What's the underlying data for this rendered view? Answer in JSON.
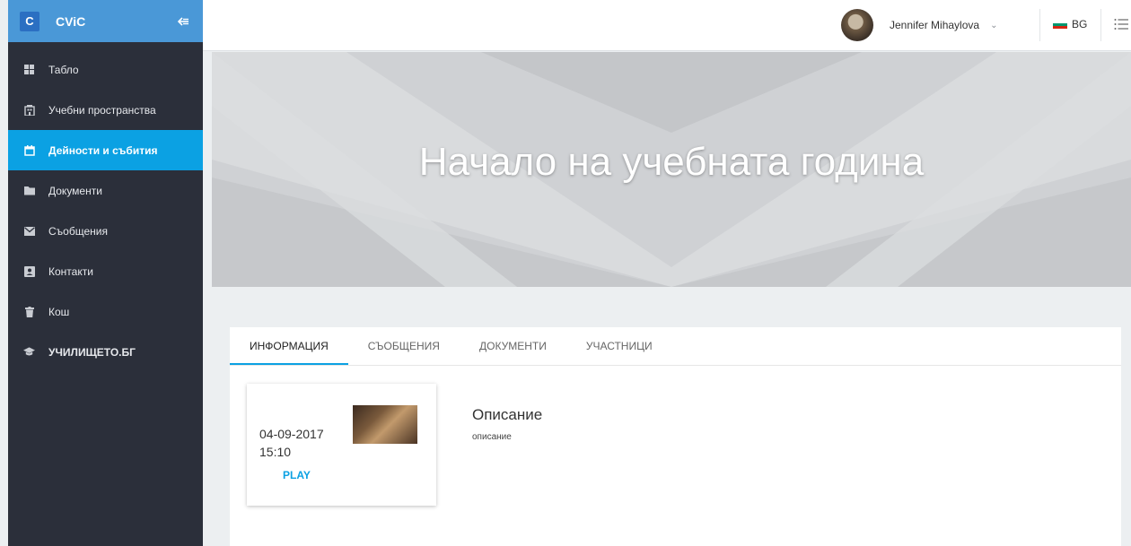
{
  "brand": {
    "logo_letter": "C",
    "name": "CViC"
  },
  "sidebar": {
    "items": [
      {
        "label": "Табло",
        "icon": "grid-icon"
      },
      {
        "label": "Учебни пространства",
        "icon": "building-icon"
      },
      {
        "label": "Дейности и събития",
        "icon": "calendar-icon",
        "active": true
      },
      {
        "label": "Документи",
        "icon": "folder-icon"
      },
      {
        "label": "Съобщения",
        "icon": "envelope-icon"
      },
      {
        "label": "Контакти",
        "icon": "contact-card-icon"
      },
      {
        "label": "Кош",
        "icon": "trash-icon"
      },
      {
        "label": "УЧИЛИЩЕТО.БГ",
        "icon": "graduation-cap-icon"
      }
    ]
  },
  "topbar": {
    "user_name": "Jennifer Mihaylova",
    "language": "BG"
  },
  "banner": {
    "title": "Начало на учебната година"
  },
  "tabs": [
    "ИНФОРМАЦИЯ",
    "СЪОБЩЕНИЯ",
    "ДОКУМЕНТИ",
    "УЧАСТНИЦИ"
  ],
  "event": {
    "date": "04-09-2017",
    "time": "15:10",
    "play_label": "PLAY"
  },
  "description": {
    "title": "Описание",
    "text": "описание"
  },
  "colors": {
    "accent": "#0ba1e3",
    "sidebar_bg": "#2b2f3a",
    "brand_bg": "#4a98d7"
  }
}
